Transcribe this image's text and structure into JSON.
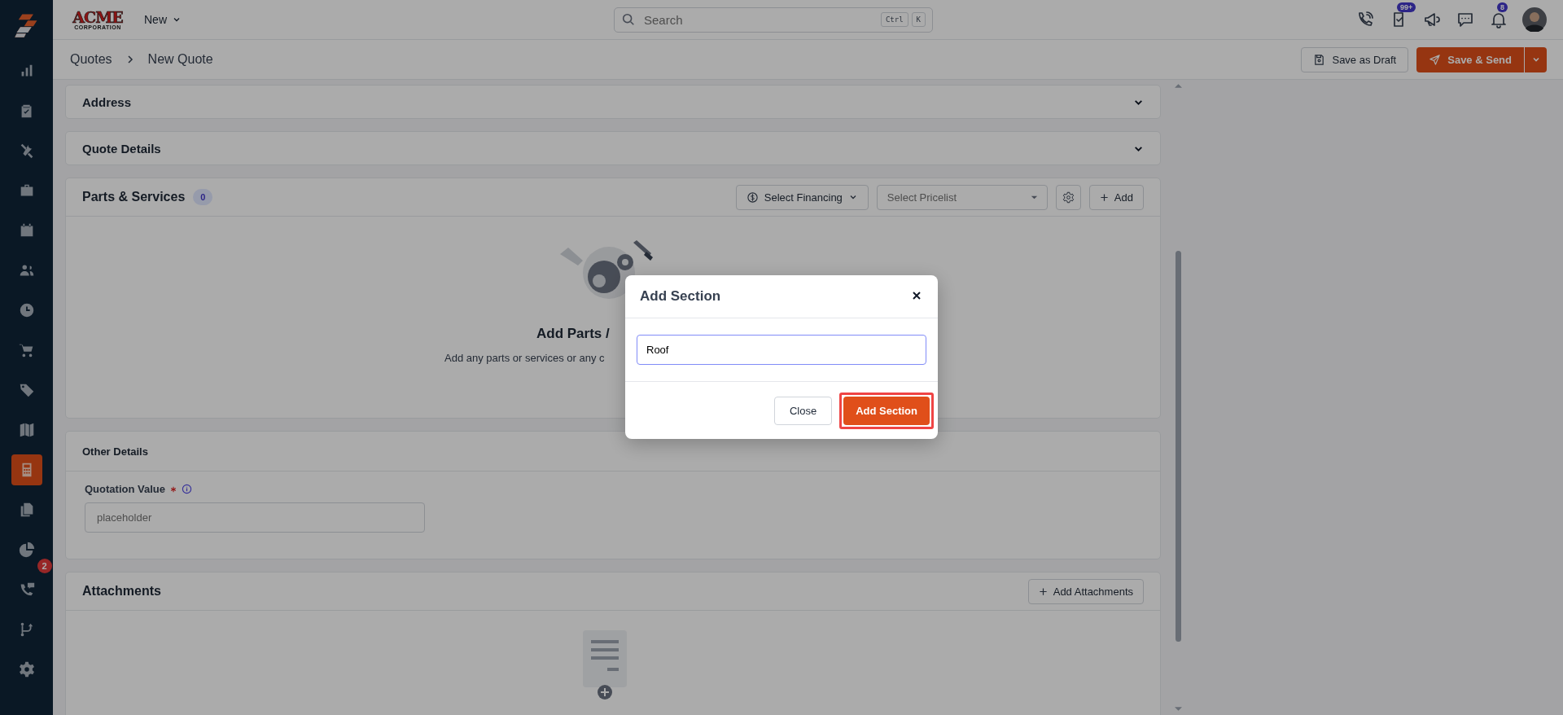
{
  "sidebar": {
    "items": [
      {
        "selected": false
      },
      {
        "selected": false
      },
      {
        "selected": false
      },
      {
        "selected": false
      },
      {
        "selected": false
      },
      {
        "selected": false
      },
      {
        "selected": false
      },
      {
        "selected": false
      },
      {
        "selected": false
      },
      {
        "selected": false
      },
      {
        "selected": true
      },
      {
        "selected": false
      },
      {
        "selected": false
      },
      {
        "selected": false,
        "badge": "2"
      },
      {
        "selected": false
      },
      {
        "selected": false
      }
    ]
  },
  "topbar": {
    "logo": {
      "name": "ACME",
      "tagline": "CORPORATION"
    },
    "new_menu": "New",
    "search": {
      "placeholder": "Search",
      "keys": [
        "Ctrl",
        "K"
      ]
    },
    "icons": [
      {
        "kind": "phone"
      },
      {
        "kind": "tasks",
        "badge": "99+"
      },
      {
        "kind": "megaphone"
      },
      {
        "kind": "chat"
      },
      {
        "kind": "bell",
        "badge": "8"
      }
    ]
  },
  "breadcrumb": [
    "Quotes",
    "New Quote"
  ],
  "actions": {
    "draft": "Save as Draft",
    "send": "Save & Send"
  },
  "sections": [
    {
      "kind": "collapsible",
      "title": "Address",
      "expanded": false
    },
    {
      "kind": "collapsible",
      "title": "Quote Details",
      "expanded": false
    },
    {
      "kind": "parts",
      "title": "Parts & Services",
      "count": "0",
      "financing": "Select Financing",
      "pricelist_placeholder": "Select Pricelist",
      "add": "Add",
      "empty_title": "Add Parts /",
      "empty_text": "Add any parts or services or any c"
    },
    {
      "kind": "details",
      "title": "Other Details",
      "field": {
        "label": "Quotation Value",
        "required": true,
        "placeholder": "placeholder"
      }
    },
    {
      "kind": "attachments",
      "title": "Attachments",
      "add": "Add Attachments"
    }
  ],
  "modal": {
    "title": "Add Section",
    "input_value": "Roof",
    "buttons": [
      {
        "label": "Close",
        "kind": "secondary",
        "highlighted": false
      },
      {
        "label": "Add Section",
        "kind": "primary",
        "highlighted": true
      }
    ]
  }
}
